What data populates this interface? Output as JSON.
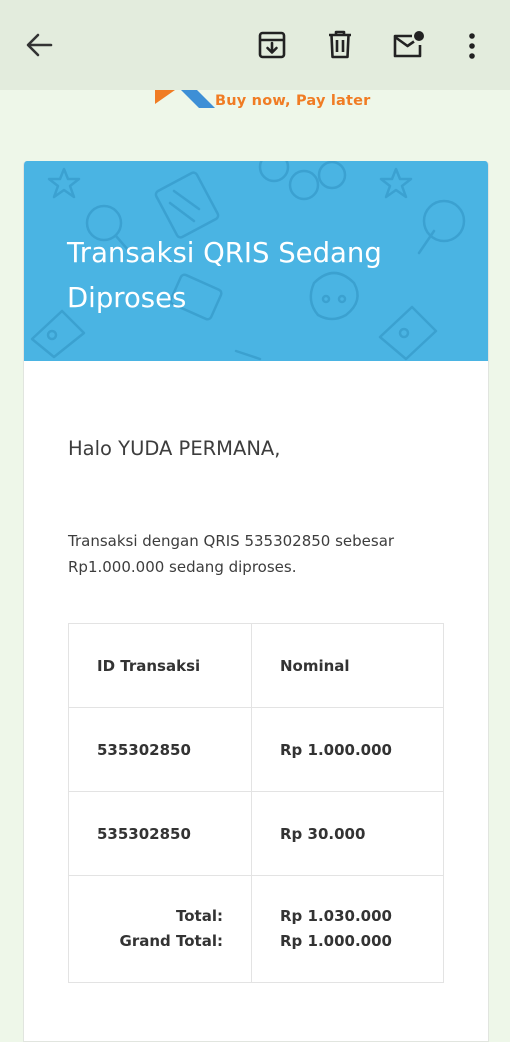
{
  "toolbar": {
    "icons": [
      "back-arrow-icon",
      "archive-icon",
      "delete-icon",
      "mark-unread-icon",
      "more-vert-icon"
    ],
    "background": "#e3ecdd"
  },
  "brand": {
    "tagline": "Buy now, Pay later",
    "colors": {
      "orange": "#f07c24",
      "blue": "#3d8fd6"
    }
  },
  "email": {
    "banner_title": "Transaksi QRIS Sedang Diproses",
    "banner_color": "#4ab4e3",
    "greeting": "Halo YUDA PERMANA,",
    "message": "Transaksi dengan QRIS 535302850 sebesar Rp1.000.000 sedang diproses.",
    "table": {
      "headers": {
        "id": "ID Transaksi",
        "amount": "Nominal"
      },
      "rows": [
        {
          "id": "535302850",
          "amount": "Rp 1.000.000"
        },
        {
          "id": "535302850",
          "amount": "Rp 30.000"
        }
      ],
      "totals": {
        "total_label": "Total:",
        "total_value": "Rp 1.030.000",
        "grand_label": "Grand Total:",
        "grand_value": "Rp 1.000.000"
      }
    }
  }
}
